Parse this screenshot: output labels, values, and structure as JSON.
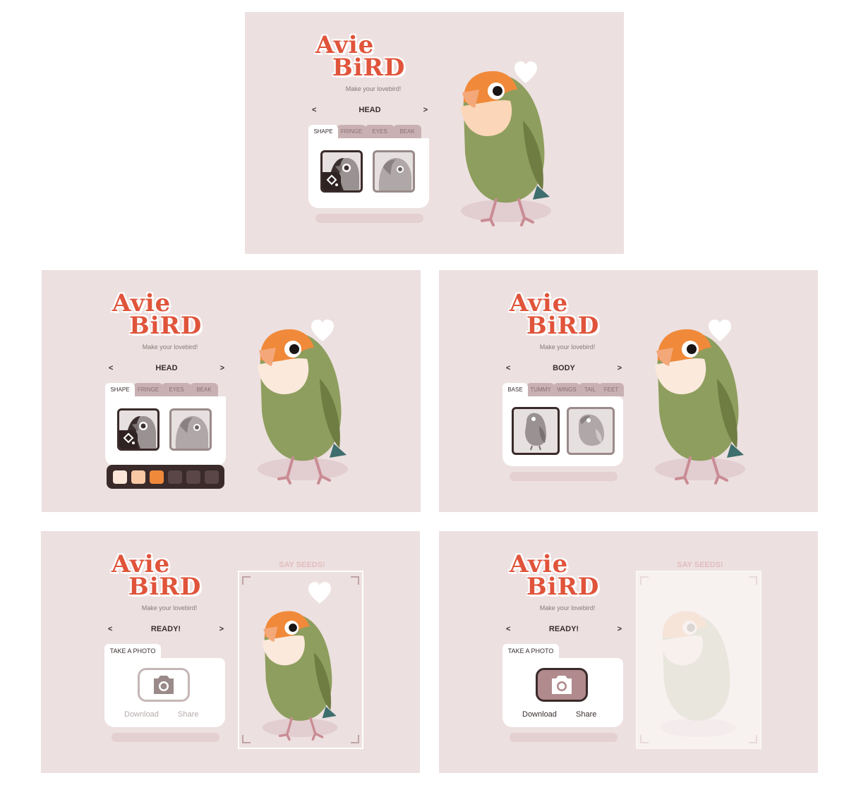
{
  "brand": {
    "line1": "Avie",
    "line2": "BiRD",
    "tagline": "Make your lovebird!"
  },
  "nav": {
    "prev": "<",
    "next": ">"
  },
  "colors": {
    "background": "#ede0e0",
    "accent": "#e0543b",
    "dark": "#3a2a2a",
    "bird_green": "#8e9e5e",
    "bird_orange": "#f08a3a",
    "bird_face": "#fbd6b8"
  },
  "screens": [
    {
      "section": "HEAD",
      "tabs": [
        "SHAPE",
        "FRINGE",
        "EYES",
        "BEAK"
      ],
      "active_tab": "SHAPE"
    },
    {
      "section": "HEAD",
      "tabs": [
        "SHAPE",
        "FRINGE",
        "EYES",
        "BEAK"
      ],
      "active_tab": "SHAPE",
      "palette": [
        "#fbe6d8",
        "#f9c9a5",
        "#f08a3a",
        "#5a4646",
        "#5a4646",
        "#5a4646"
      ]
    },
    {
      "section": "BODY",
      "tabs": [
        "BASE",
        "TUMMY",
        "WINGS",
        "TAIL",
        "FEET"
      ],
      "active_tab": "BASE"
    },
    {
      "section": "READY!",
      "tab": "TAKE A PHOTO",
      "download": "Download",
      "share": "Share",
      "photo_caption": "SAY SEEDS!"
    },
    {
      "section": "READY!",
      "tab": "TAKE A PHOTO",
      "download": "Download",
      "share": "Share",
      "photo_caption": "SAY SEEDS!"
    }
  ]
}
